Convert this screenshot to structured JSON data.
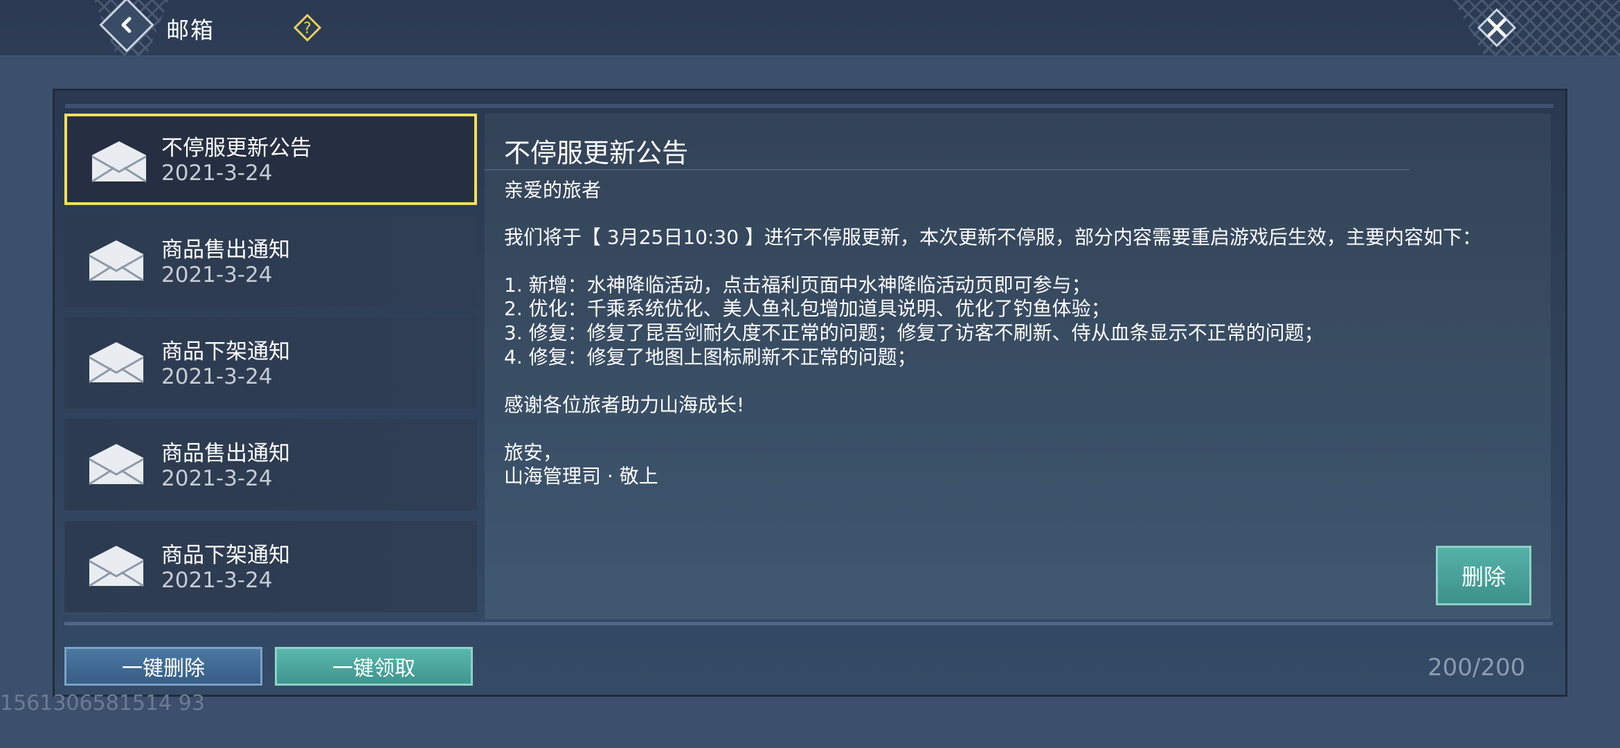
{
  "header": {
    "title": "邮箱",
    "back_icon": "back-arrow-icon",
    "help_icon": "question-icon",
    "close_icon": "close-icon"
  },
  "mail_list": {
    "items": [
      {
        "subject": "不停服更新公告",
        "date": "2021-3-24",
        "selected": true
      },
      {
        "subject": "商品售出通知",
        "date": "2021-3-24",
        "selected": false
      },
      {
        "subject": "商品下架通知",
        "date": "2021-3-24",
        "selected": false
      },
      {
        "subject": "商品售出通知",
        "date": "2021-3-24",
        "selected": false
      },
      {
        "subject": "商品下架通知",
        "date": "2021-3-24",
        "selected": false
      }
    ]
  },
  "mail_content": {
    "title": "不停服更新公告",
    "lines": [
      "亲爱的旅者",
      "我们将于【 3月25日10:30 】进行不停服更新，本次更新不停服，部分内容需要重启游戏后生效，主要内容如下：",
      "1. 新增：水神降临活动，点击福利页面中水神降临活动页即可参与；",
      "2. 优化：千乘系统优化、美人鱼礼包增加道具说明、优化了钓鱼体验；",
      "3. 修复：修复了昆吾剑耐久度不正常的问题；修复了访客不刷新、侍从血条显示不正常的问题；",
      "4. 修复：修复了地图上图标刷新不正常的问题；",
      "感谢各位旅者助力山海成长!",
      "旅安，",
      "山海管理司 · 敬上"
    ],
    "delete_label": "删除"
  },
  "footer": {
    "delete_all_label": "一键删除",
    "claim_all_label": "一键领取",
    "mail_count": "200/200",
    "uid": "1561306581514 93"
  },
  "colors": {
    "selected_border": "#f2df5a",
    "teal_button": "#4aa59c",
    "blue_button": "#41688f"
  }
}
